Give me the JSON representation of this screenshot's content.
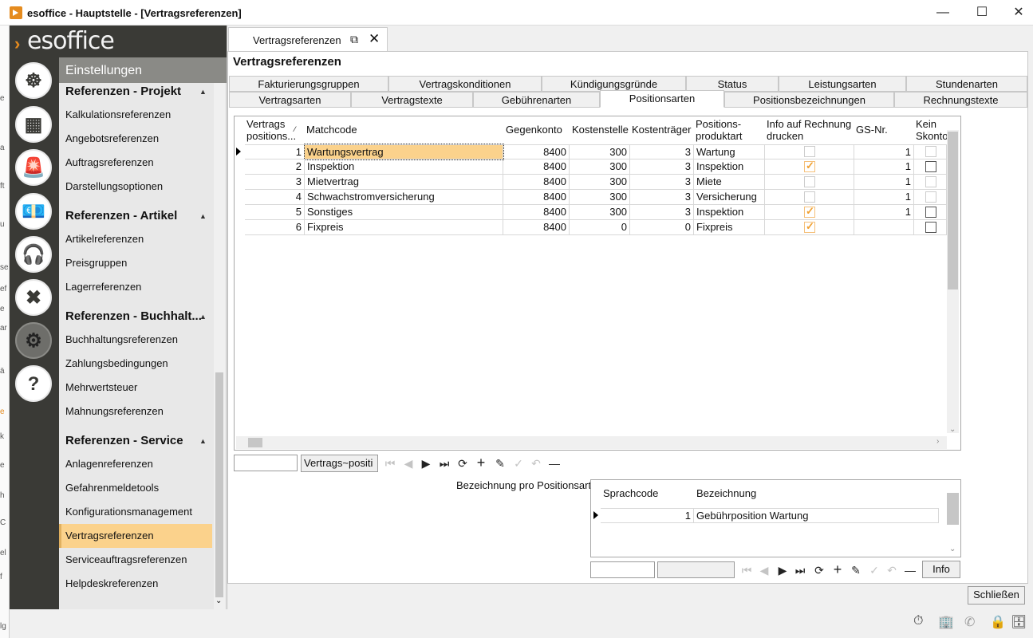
{
  "window": {
    "title": "esoffice - Hauptstelle - [Vertragsreferenzen]",
    "minimize": "—",
    "maximize": "☐",
    "close": "✕"
  },
  "bg_window_letters": [
    "e",
    "a",
    "ft",
    "u",
    "se",
    "ef",
    "e",
    "ar",
    "ä",
    "e",
    "k",
    "e",
    "h",
    "C",
    "el",
    "f",
    "lg"
  ],
  "app": {
    "logo": "esoffice"
  },
  "nav_icons": [
    "helm-icon",
    "building-plan-icon",
    "alarm-light-icon",
    "money-icon",
    "headset-icon",
    "tools-icon",
    "gears-icon",
    "help-icon"
  ],
  "nav_glyphs": [
    "☸",
    "▦",
    "🚨",
    "💶",
    "🎧",
    "✖",
    "⚙",
    "?"
  ],
  "menu": {
    "header": "Einstellungen",
    "groups": [
      {
        "title": "Referenzen - Projekt",
        "items": [
          "Kalkulationsreferenzen",
          "Angebotsreferenzen",
          "Auftragsreferenzen",
          "Darstellungsoptionen"
        ]
      },
      {
        "title": "Referenzen - Artikel",
        "items": [
          "Artikelreferenzen",
          "Preisgruppen",
          "Lagerreferenzen"
        ]
      },
      {
        "title": "Referenzen - Buchhalt...",
        "items": [
          "Buchhaltungsreferenzen",
          "Zahlungsbedingungen",
          "Mehrwertsteuer",
          "Mahnungsreferenzen"
        ]
      },
      {
        "title": "Referenzen - Service",
        "items": [
          "Anlagenreferenzen",
          "Gefahrenmeldetools",
          "Konfigurationsmanagement",
          "Vertragsreferenzen",
          "Serviceauftragsreferenzen",
          "Helpdeskreferenzen"
        ]
      }
    ],
    "selected": "Vertragsreferenzen"
  },
  "doc_tab": {
    "label": "Vertragsreferenzen"
  },
  "page_title": "Vertragsreferenzen",
  "tabs_row1": [
    "Fakturierungsgruppen",
    "Vertragskonditionen",
    "Kündigungsgründe",
    "Status",
    "Leistungsarten",
    "Stundenarten"
  ],
  "tabs_row2": [
    "Vertragsarten",
    "Vertragstexte",
    "Gebührenarten",
    "Positionsarten",
    "Positionsbezeichnungen",
    "Rechnungstexte"
  ],
  "active_tab": "Positionsarten",
  "grid": {
    "headers": {
      "nr": "Vertrags positions...",
      "sort": "⁄",
      "matchcode": "Matchcode",
      "gegenkonto": "Gegenkonto",
      "kostenstelle": "Kostenstelle",
      "kostentraeger": "Kostenträger",
      "produktart": "Positions- produktart",
      "info": "Info auf Rechnung drucken",
      "gsnr": "GS-Nr.",
      "skonto": "Kein Skonto"
    },
    "rows": [
      {
        "nr": "1",
        "matchcode": "Wartungsvertrag",
        "gegenkonto": "8400",
        "kostenstelle": "300",
        "kostentraeger": "3",
        "produktart": "Wartung",
        "info": "unchecked-disabled",
        "gsnr": "1",
        "skonto": "unchecked-disabled"
      },
      {
        "nr": "2",
        "matchcode": "Inspektion",
        "gegenkonto": "8400",
        "kostenstelle": "300",
        "kostentraeger": "3",
        "produktart": "Inspektion",
        "info": "checked",
        "gsnr": "1",
        "skonto": "unchecked"
      },
      {
        "nr": "3",
        "matchcode": "Mietvertrag",
        "gegenkonto": "8400",
        "kostenstelle": "300",
        "kostentraeger": "3",
        "produktart": "Miete",
        "info": "unchecked-disabled",
        "gsnr": "1",
        "skonto": "unchecked-disabled"
      },
      {
        "nr": "4",
        "matchcode": "Schwachstromversicherung",
        "gegenkonto": "8400",
        "kostenstelle": "300",
        "kostentraeger": "3",
        "produktart": "Versicherung",
        "info": "unchecked-disabled",
        "gsnr": "1",
        "skonto": "unchecked-disabled"
      },
      {
        "nr": "5",
        "matchcode": "Sonstiges",
        "gegenkonto": "8400",
        "kostenstelle": "300",
        "kostentraeger": "3",
        "produktart": "Inspektion",
        "info": "checked",
        "gsnr": "1",
        "skonto": "unchecked"
      },
      {
        "nr": "6",
        "matchcode": "Fixpreis",
        "gegenkonto": "8400",
        "kostenstelle": "0",
        "kostentraeger": "0",
        "produktart": "Fixpreis",
        "info": "checked",
        "gsnr": "",
        "skonto": "unchecked"
      }
    ],
    "selected_row": 0
  },
  "grid_toolbar": {
    "search_value": "",
    "column_select": "Vertrags~positi"
  },
  "sub": {
    "label": "Bezeichnung pro Positionsart",
    "headers": {
      "sprachcode": "Sprachcode",
      "bezeichnung": "Bezeichnung"
    },
    "rows": [
      {
        "sprachcode": "1",
        "bezeichnung": "Gebührposition Wartung"
      }
    ],
    "info_button": "Info"
  },
  "nav_glyphs_toolbar": [
    "⏮",
    "◀",
    "▶",
    "⏭",
    "⟳",
    "+",
    "✎",
    "✓",
    "↶",
    "—"
  ],
  "close_button": "Schließen",
  "status_icons": [
    "stopwatch-icon",
    "building-icon",
    "phone-icon",
    "lock-icon",
    "database-icon"
  ],
  "status_glyphs": [
    "⏱",
    "🏢",
    "✆",
    "🔒",
    "🗄"
  ]
}
